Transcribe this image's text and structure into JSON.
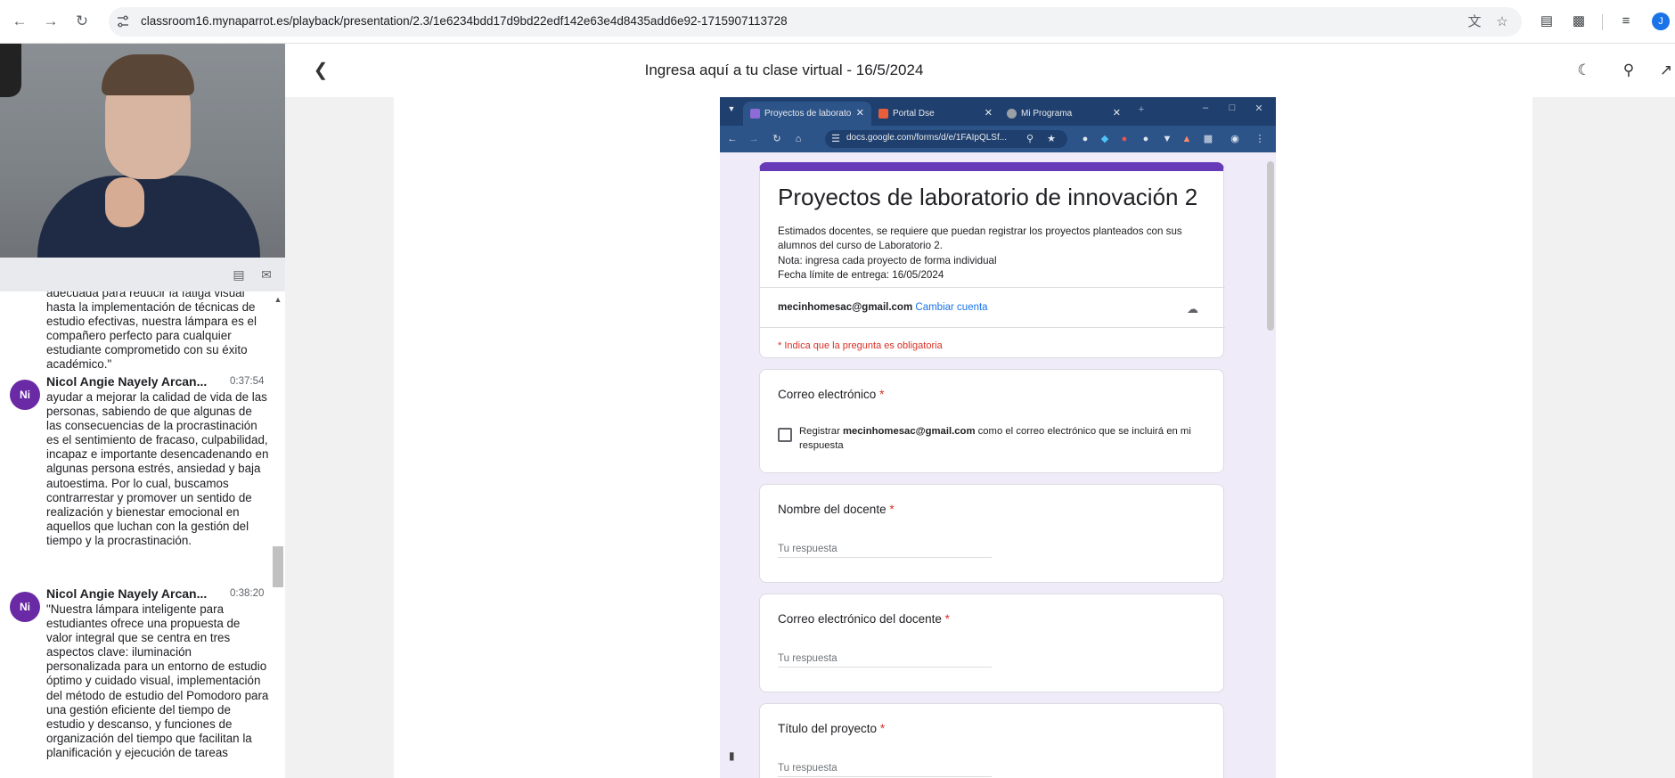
{
  "browser": {
    "url": "classroom16.mynaparrot.es/playback/presentation/2.3/1e6234bdd17d9bd22edf142e63e4d8435add6e92-1715907113728",
    "profile_initial": "J"
  },
  "viewer": {
    "title": "Ingresa aquí a tu clase virtual - 16/5/2024"
  },
  "chat": {
    "fragment": "adecuada para reducir la fatiga visual hasta la implementación de técnicas de estudio efectivas, nuestra lámpara es el compañero perfecto para cualquier estudiante comprometido con su éxito académico.\"",
    "messages": [
      {
        "initials": "Ni",
        "name": "Nicol Angie Nayely Arcan...",
        "time": "0:37:54",
        "text": "ayudar a mejorar la calidad de vida de las personas, sabiendo de que algunas de las consecuencias de la procrastinación es el sentimiento de fracaso, culpabilidad, incapaz e importante desencadenando en algunas persona estrés, ansiedad y baja autoestima. Por lo cual, buscamos contrarrestar y promover un sentido de realización y bienestar emocional en aquellos que luchan con la gestión del tiempo y la procrastinación."
      },
      {
        "initials": "Ni",
        "name": "Nicol Angie Nayely Arcan...",
        "time": "0:38:20",
        "text": "\"Nuestra lámpara inteligente para estudiantes ofrece una propuesta de valor integral que se centra en tres aspectos clave: iluminación personalizada para un entorno de estudio óptimo y cuidado visual, implementación del método de estudio del Pomodoro para una gestión eficiente del tiempo de estudio y descanso, y funciones de organización del tiempo que facilitan la planificación y ejecución de tareas"
      }
    ]
  },
  "shared_screen": {
    "tabs": [
      {
        "label": "Proyectos de laborato"
      },
      {
        "label": "Portal Dse"
      },
      {
        "label": "Mi Programa"
      }
    ],
    "url": "docs.google.com/forms/d/e/1FAIpQLSf...",
    "form": {
      "title": "Proyectos de laboratorio de innovación 2",
      "description": [
        "Estimados docentes, se requiere que puedan registrar los proyectos planteados con sus alumnos del curso de Laboratorio 2.",
        "Nota: ingresa cada proyecto de forma individual",
        "Fecha límite de entrega: 16/05/2024"
      ],
      "account": "mecinhomesac@gmail.com",
      "switch_account": "Cambiar cuenta",
      "required_note": "* Indica que la pregunta es obligatoria",
      "questions": [
        {
          "label": "Correo electrónico",
          "checkbox_prefix": "Registrar ",
          "checkbox_email": "mecinhomesac@gmail.com",
          "checkbox_suffix": " como el correo electrónico que se incluirá en mi respuesta"
        },
        {
          "label": "Nombre del docente",
          "placeholder": "Tu respuesta"
        },
        {
          "label": "Correo electrónico del docente",
          "placeholder": "Tu respuesta"
        },
        {
          "label": "Título del proyecto",
          "placeholder": "Tu respuesta"
        }
      ],
      "required_star": "*"
    }
  },
  "colors": {
    "accent": "#673ab7",
    "form_bg": "#f0ebf8",
    "avatar": "#6a2aa6",
    "required": "#d93025",
    "link": "#1a73e8"
  }
}
